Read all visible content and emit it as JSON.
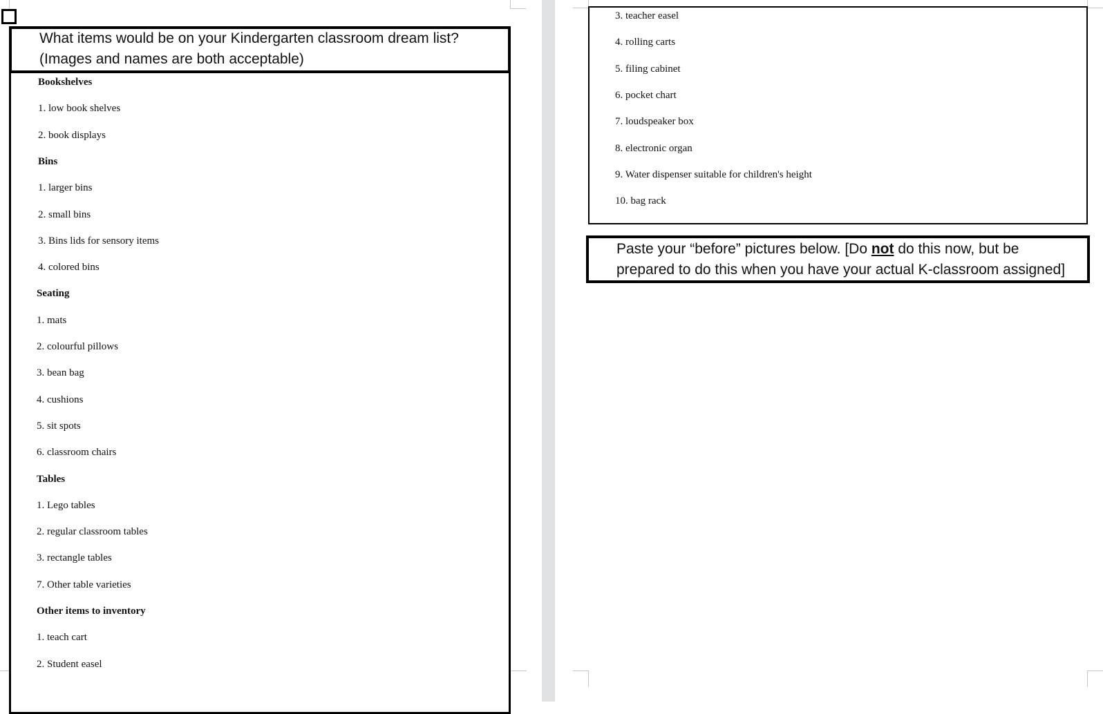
{
  "left_page": {
    "question": {
      "line1": "What items would be on your Kindergarten classroom dream list?",
      "line2": "(Images and names are both acceptable)"
    },
    "sections": [
      {
        "heading": "Bookshelves",
        "items": [
          "1. low book shelves",
          "2. book displays"
        ]
      },
      {
        "heading": "Bins",
        "items": [
          "1. larger bins",
          "2. small bins",
          "3. Bins lids for sensory items",
          "4. colored bins"
        ]
      },
      {
        "heading": "Seating",
        "items": [
          "1. mats",
          "2. colourful pillows",
          "3. bean bag",
          "4. cushions",
          "5. sit spots",
          "6. classroom chairs"
        ]
      },
      {
        "heading": "Tables",
        "items": [
          "1. Lego tables",
          "2. regular classroom tables",
          "3. rectangle tables",
          "7. Other table varieties"
        ]
      },
      {
        "heading": "Other items to inventory",
        "items": [
          "1. teach cart",
          "2. Student easel"
        ]
      }
    ]
  },
  "right_page": {
    "continued_items": [
      "3. teacher easel",
      "4. rolling carts",
      "5. filing cabinet",
      "6. pocket chart",
      "7. loudspeaker box",
      "8. electronic organ",
      "9. Water dispenser suitable for children's height",
      "10. bag rack"
    ],
    "instruction": {
      "line1_before": "Paste your “before” pictures below. [Do ",
      "line1_emphasis": "not",
      "line1_after": " do this now, but be",
      "line2": "prepared to do this when you have your actual K-classroom assigned]"
    }
  },
  "colors": {
    "gutter": "#e0e1e3",
    "border": "#000000",
    "crop_marks": "#c6c6c6"
  }
}
